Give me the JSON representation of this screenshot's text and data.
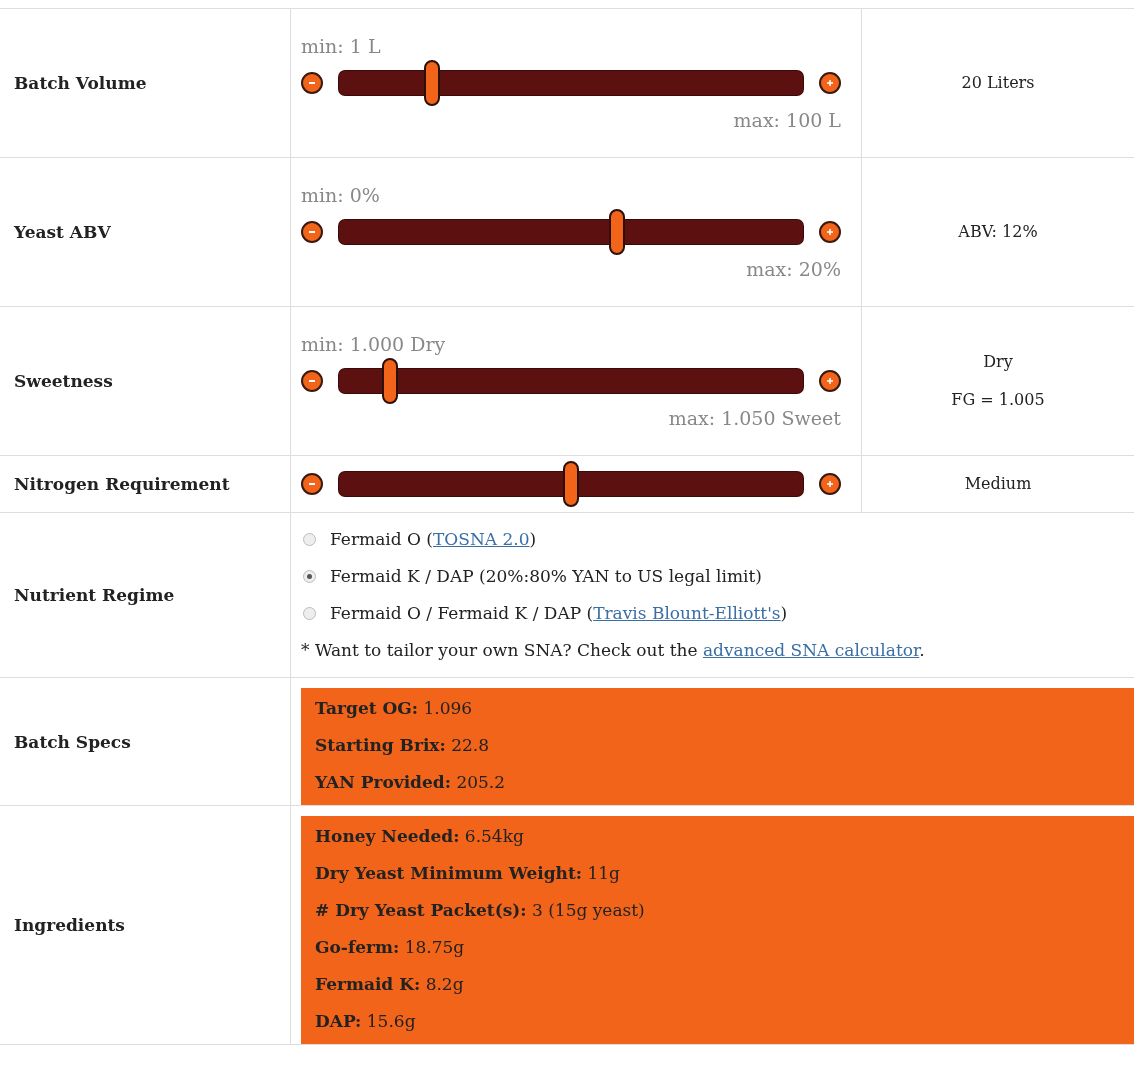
{
  "rows": [
    {
      "kind": "slider",
      "label": "Batch Volume",
      "min_label": "min: 1 L",
      "max_label": "max: 100 L",
      "level": 0.2,
      "value_lines": [
        "20 Liters"
      ]
    },
    {
      "kind": "slider",
      "label": "Yeast ABV",
      "min_label": "min: 0%",
      "max_label": "max: 20%",
      "level": 0.6,
      "value_lines": [
        "ABV: 12%"
      ]
    },
    {
      "kind": "slider",
      "label": "Sweetness",
      "min_label": "min: 1.000 Dry",
      "max_label": "max: 1.050 Sweet",
      "level": 0.11,
      "value_lines": [
        "Dry",
        "FG = 1.005"
      ]
    },
    {
      "kind": "slider",
      "label": "Nitrogen Requirement",
      "level": 0.5,
      "value_lines": [
        "Medium"
      ]
    },
    {
      "kind": "radio",
      "label": "Nutrient Regime",
      "options": [
        {
          "text": "Fermaid O (",
          "link": "TOSNA 2.0",
          "after": ")",
          "selected": false
        },
        {
          "text": "Fermaid K / DAP (20%:80% YAN to US legal limit)",
          "selected": true
        },
        {
          "text": "Fermaid O / Fermaid K / DAP (",
          "link": "Travis Blount-Elliott's",
          "after": ")",
          "selected": false
        }
      ],
      "note": {
        "text": "* Want to tailor your own SNA? Check out the ",
        "link": "advanced SNA calculator",
        "after": "."
      }
    },
    {
      "kind": "specs",
      "label": "Batch Specs",
      "lines": [
        "**Target OG:** 1.096",
        "**Starting Brix:** 22.8",
        "**YAN Provided:** 205.2"
      ]
    },
    {
      "kind": "specs",
      "label": "Ingredients",
      "lines": [
        "**Honey Needed:** 6.54kg",
        "**Dry Yeast Minimum Weight:** 11g",
        "**# Dry Yeast Packet(s):** 3 (15g yeast)",
        "**Go-ferm:** 18.75g",
        "**Fermaid K:** 8.2g",
        "**DAP:** 15.6g"
      ]
    }
  ]
}
